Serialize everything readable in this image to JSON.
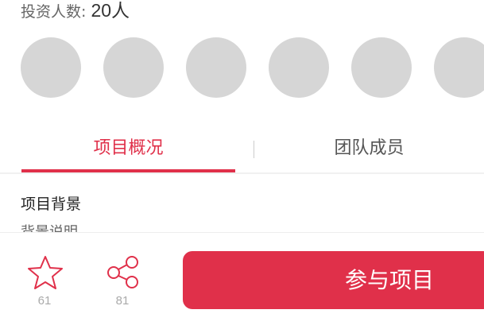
{
  "investors": {
    "label": "投资人数:",
    "count": "20人"
  },
  "avatars": 6,
  "tabs": [
    {
      "label": "项目概况",
      "active": true
    },
    {
      "label": "团队成员",
      "active": false
    }
  ],
  "section": {
    "title": "项目背景",
    "description": "背景说明"
  },
  "actions": {
    "favorite_count": "61",
    "share_count": "81",
    "join_label": "参与项目"
  },
  "colors": {
    "accent": "#e0304a"
  }
}
